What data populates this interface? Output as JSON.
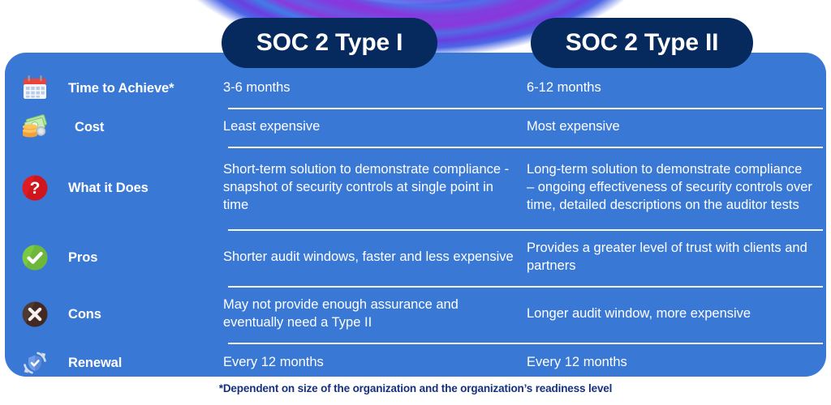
{
  "header": {
    "columns": [
      {
        "label": "SOC 2 Type I",
        "id": "soc2-type-1"
      },
      {
        "label": "SOC 2 Type II",
        "id": "soc2-type-2"
      }
    ],
    "pill_color": "#062a5e"
  },
  "card": {
    "background_color": "#3a78d6",
    "text_color": "#ffffff"
  },
  "rows": [
    {
      "icon": "calendar-icon",
      "label": "Time to Achieve*",
      "type1": "3-6 months",
      "type2": "6-12 months"
    },
    {
      "icon": "money-icon",
      "label": "Cost",
      "type1": "Least expensive",
      "type2": "Most expensive"
    },
    {
      "icon": "question-mark-icon",
      "label": "What it Does",
      "type1": "Short-term solution to demonstrate compliance - snapshot of security controls at single point in time",
      "type2": "Long-term solution to demonstrate compliance – ongoing effectiveness of security controls over time, detailed descriptions on the auditor tests"
    },
    {
      "icon": "check-circle-icon",
      "label": "Pros",
      "type1": "Shorter audit windows, faster and less expensive",
      "type2": "Provides a greater level of trust with clients and partners"
    },
    {
      "icon": "x-circle-icon",
      "label": "Cons",
      "type1": "May not provide enough assurance and eventually need a Type II",
      "type2": "Longer audit window, more expensive"
    },
    {
      "icon": "renewal-shield-icon",
      "label": "Renewal",
      "type1": "Every 12 months",
      "type2": "Every 12 months"
    }
  ],
  "footnote": {
    "text": "*Dependent on size of the organization and the organization’s readiness level",
    "color": "#16307e"
  }
}
